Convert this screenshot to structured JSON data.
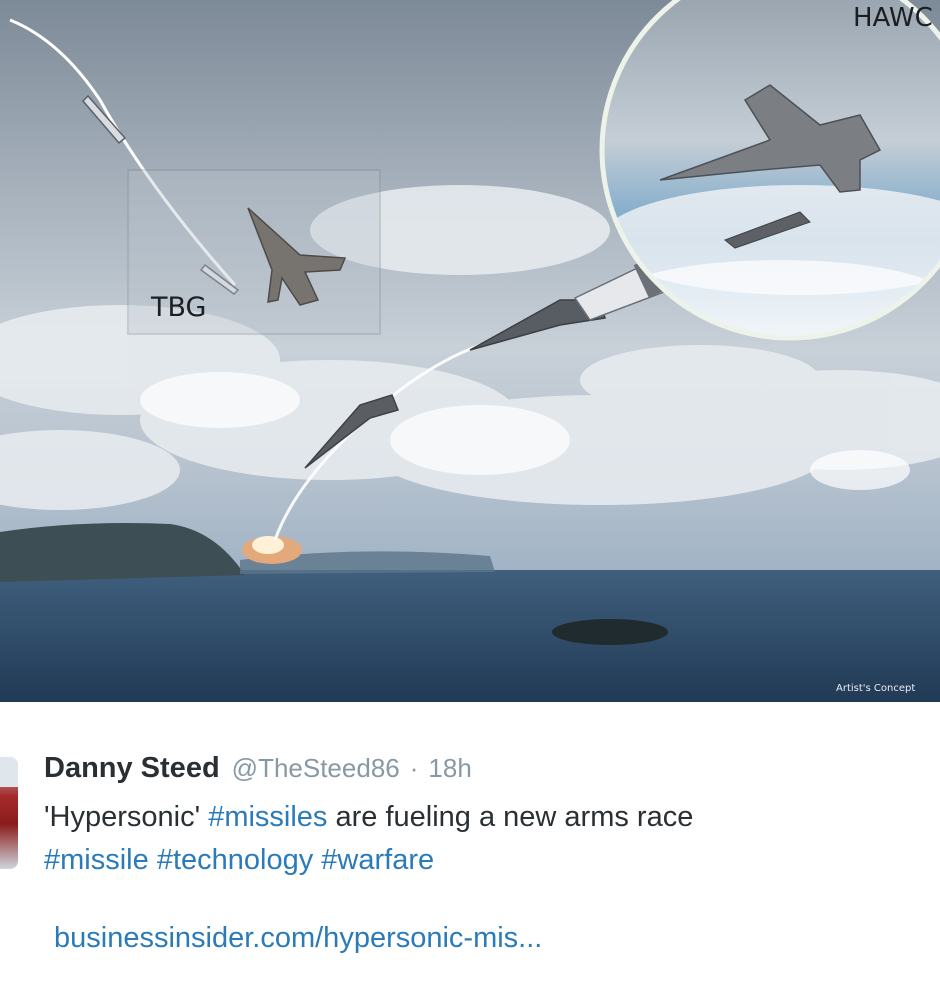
{
  "media": {
    "labels": {
      "tbg": "TBG",
      "hawc": "HAWC",
      "caption": "Artist's Concept"
    }
  },
  "tweet": {
    "author_name": "Danny Steed",
    "handle": "@TheSteed86",
    "separator": "·",
    "time": "18h",
    "text_pre": "'Hypersonic' ",
    "tag1": "#missiles",
    "text_mid": " are fueling a new arms race",
    "tag2": "#missile",
    "tag3": "#technology",
    "tag4": "#warfare",
    "link": "businessinsider.com/hypersonic-mis..."
  },
  "colors": {
    "link": "#2b7bb9",
    "text": "#292f33",
    "muted": "#8899a6"
  }
}
